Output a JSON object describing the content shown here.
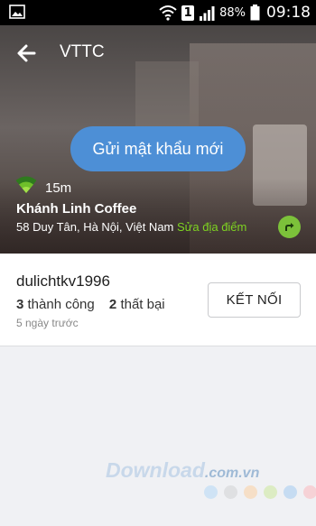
{
  "status_bar": {
    "sim_slot": "1",
    "battery": "88%",
    "time": "09:18"
  },
  "header": {
    "title": "VTTC"
  },
  "hero": {
    "send_password_label": "Gửi mật khẩu mới",
    "distance": "15m",
    "place_name": "Khánh Linh Coffee",
    "address": "58 Duy Tân, Hà Nội, Việt Nam",
    "edit_place_label": "Sửa địa điểm"
  },
  "network_card": {
    "username": "dulichtkv1996",
    "success_count": "3",
    "success_label": "thành công",
    "fail_count": "2",
    "fail_label": "thất bại",
    "time_ago": "5 ngày trước",
    "connect_label": "KẾT NỐI"
  },
  "watermark": {
    "text": "Download",
    "domain": ".com.vn",
    "dot_colors": [
      "#cfe3f5",
      "#dfe0e2",
      "#f6dfc7",
      "#dcecc3",
      "#c6dcf2",
      "#f6d2d6"
    ]
  },
  "colors": {
    "accent_blue": "#4d8fd6",
    "accent_green": "#7ed321"
  }
}
